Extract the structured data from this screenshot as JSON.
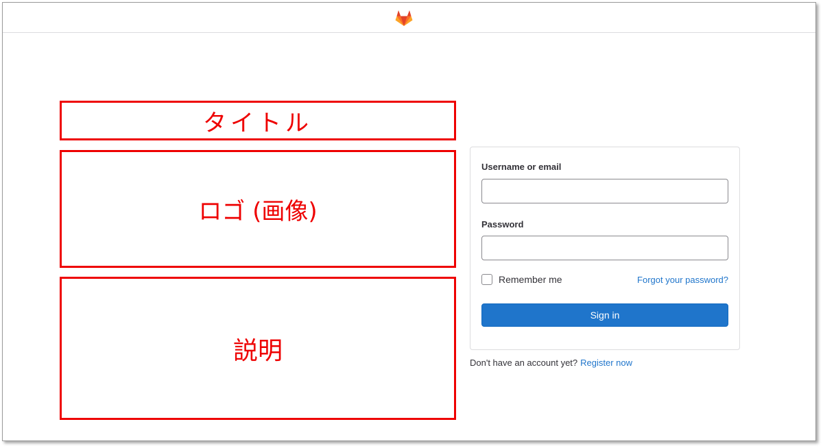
{
  "colors": {
    "accent": "#1f75cb",
    "annotation": "#ee0000",
    "border": "#dcdcde"
  },
  "header": {
    "logo_icon": "gitlab-tanuki-icon"
  },
  "annotations": {
    "title": "タイトル",
    "logo": "ロゴ (画像)",
    "description": "説明"
  },
  "login": {
    "username_label": "Username or email",
    "username_value": "",
    "password_label": "Password",
    "password_value": "",
    "remember_label": "Remember me",
    "forgot_link": "Forgot your password?",
    "signin_button": "Sign in"
  },
  "register": {
    "prompt": "Don't have an account yet?",
    "link": "Register now"
  }
}
